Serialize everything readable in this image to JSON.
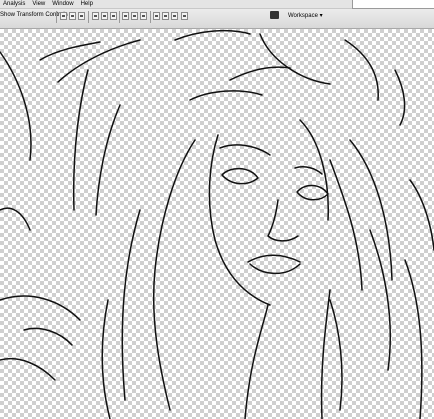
{
  "menu": {
    "items": [
      "Analysis",
      "View",
      "Window",
      "Help"
    ]
  },
  "options": {
    "show_transform_controls": "Show Transform Controls",
    "workspace_label": "Workspace ▾"
  },
  "icons": {
    "align": "align-icon",
    "distribute": "distribute-icon",
    "workspace": "workspace-icon"
  }
}
